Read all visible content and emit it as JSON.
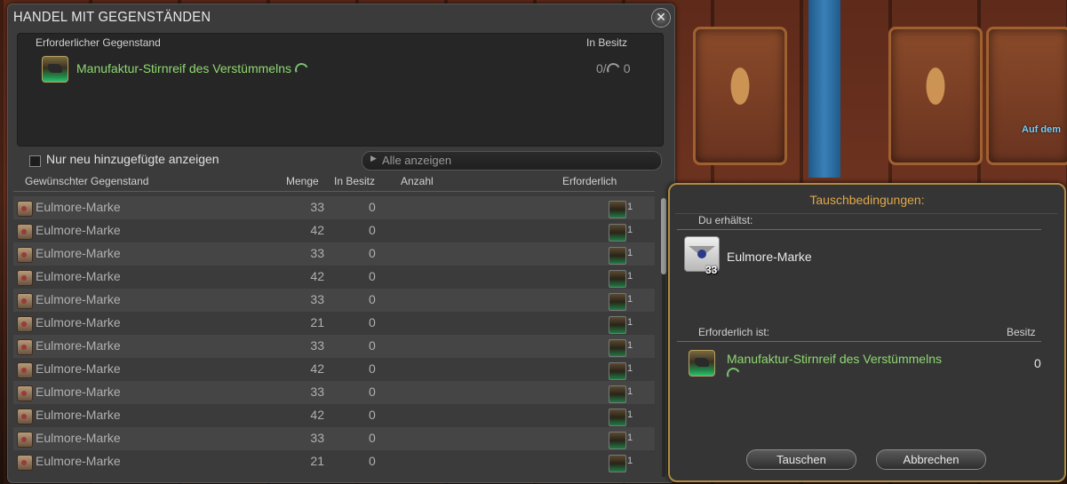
{
  "background": {
    "label": "Auf dem"
  },
  "window": {
    "title": "HANDEL MIT GEGENSTÄNDEN",
    "close_icon": "close-icon",
    "required": {
      "header_item": "Erforderlicher Gegenstand",
      "header_owned": "In Besitz",
      "item_name": "Manufaktur-Stirnreif des Verstümmelns",
      "owned_prefix": "0/",
      "owned_value": "0"
    },
    "filter": {
      "checkbox_label": "Nur neu hinzugefügte anzeigen",
      "checked": false,
      "dropdown_value": "Alle anzeigen"
    },
    "columns": {
      "item": "Gewünschter Gegenstand",
      "menge": "Menge",
      "besitz": "In Besitz",
      "anzahl": "Anzahl",
      "erforderlich": "Erforderlich"
    },
    "rows": [
      {
        "name": "Eulmore-Marke",
        "menge": "33",
        "besitz": "0",
        "req": "1"
      },
      {
        "name": "Eulmore-Marke",
        "menge": "42",
        "besitz": "0",
        "req": "1"
      },
      {
        "name": "Eulmore-Marke",
        "menge": "33",
        "besitz": "0",
        "req": "1"
      },
      {
        "name": "Eulmore-Marke",
        "menge": "42",
        "besitz": "0",
        "req": "1"
      },
      {
        "name": "Eulmore-Marke",
        "menge": "33",
        "besitz": "0",
        "req": "1"
      },
      {
        "name": "Eulmore-Marke",
        "menge": "21",
        "besitz": "0",
        "req": "1"
      },
      {
        "name": "Eulmore-Marke",
        "menge": "33",
        "besitz": "0",
        "req": "1"
      },
      {
        "name": "Eulmore-Marke",
        "menge": "42",
        "besitz": "0",
        "req": "1"
      },
      {
        "name": "Eulmore-Marke",
        "menge": "33",
        "besitz": "0",
        "req": "1"
      },
      {
        "name": "Eulmore-Marke",
        "menge": "42",
        "besitz": "0",
        "req": "1"
      },
      {
        "name": "Eulmore-Marke",
        "menge": "33",
        "besitz": "0",
        "req": "1"
      },
      {
        "name": "Eulmore-Marke",
        "menge": "21",
        "besitz": "0",
        "req": "1"
      }
    ]
  },
  "dialog": {
    "title": "Tauschbedingungen:",
    "receive_label": "Du erhältst:",
    "receive_item": "Eulmore-Marke",
    "receive_qty": "33",
    "required_label": "Erforderlich ist:",
    "owned_label": "Besitz",
    "required_item": "Manufaktur-Stirnreif des Verstümmelns",
    "required_owned": "0",
    "confirm": "Tauschen",
    "cancel": "Abbrechen"
  },
  "colors": {
    "accent_gold": "#e0a848",
    "item_green": "#8fd870"
  }
}
